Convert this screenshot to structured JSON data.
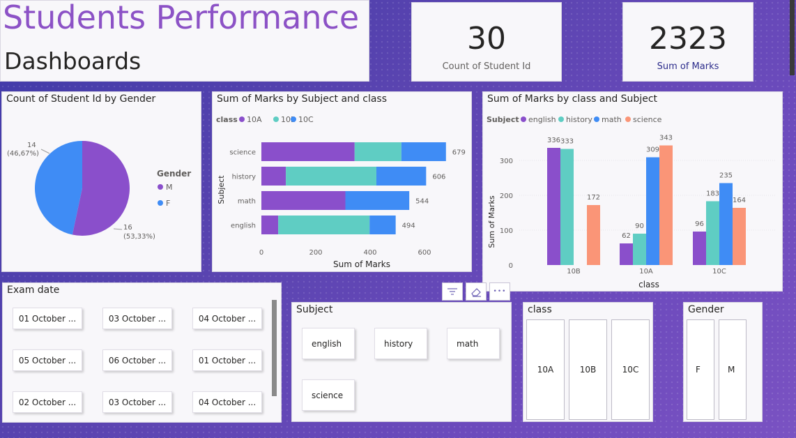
{
  "header": {
    "title": "Students Performance",
    "subtitle": "Dashboards"
  },
  "kpis": [
    {
      "value": "30",
      "label": "Count of Student Id",
      "label_color": "#605e5c"
    },
    {
      "value": "2323",
      "label": "Sum of Marks",
      "label_color": "#2a2a8a"
    }
  ],
  "colors": {
    "M": "#8a4fcb",
    "F": "#3f8cf5",
    "10A": "#8a4fcb",
    "10B": "#5fcdc3",
    "10C": "#3f8cf5",
    "english": "#8a4fcb",
    "history": "#5fcdc3",
    "math": "#3f8cf5",
    "science": "#fa9577"
  },
  "pie_card": {
    "title": "Count of Student Id by Gender",
    "legend_title": "Gender",
    "legend": [
      "M",
      "F"
    ],
    "labels": [
      {
        "value": "14",
        "pct": "(46,67%)"
      },
      {
        "value": "16",
        "pct": "(53,33%)"
      }
    ]
  },
  "hbar_card": {
    "title": "Sum of Marks by Subject and class",
    "legend_title": "class",
    "legend": [
      "10A",
      "10B",
      "10C"
    ],
    "xlabel": "Sum of Marks",
    "ylabel": "Subject",
    "x_ticks": [
      "0",
      "200",
      "400",
      "600"
    ]
  },
  "vbar_card": {
    "title": "Sum of Marks by class and Subject",
    "legend_title": "Subject",
    "legend": [
      "english",
      "history",
      "math",
      "science"
    ],
    "xlabel": "class",
    "ylabel": "Sum of Marks",
    "y_ticks": [
      "0",
      "100",
      "200",
      "300"
    ]
  },
  "chart_data": [
    {
      "type": "pie",
      "title": "Count of Student Id by Gender",
      "legend_title": "Gender",
      "categories": [
        "M",
        "F"
      ],
      "values": [
        16,
        14
      ],
      "percent": [
        53.33,
        46.67
      ]
    },
    {
      "type": "bar",
      "orientation": "horizontal",
      "stacked": true,
      "title": "Sum of Marks by Subject and class",
      "categories": [
        "science",
        "history",
        "math",
        "english"
      ],
      "series": [
        {
          "name": "10A",
          "values": [
            343,
            90,
            309,
            62
          ]
        },
        {
          "name": "10B",
          "values": [
            172,
            333,
            0,
            336
          ]
        },
        {
          "name": "10C",
          "values": [
            164,
            183,
            235,
            96
          ]
        }
      ],
      "totals": [
        679,
        606,
        544,
        494
      ],
      "xlabel": "Sum of Marks",
      "ylabel": "Subject",
      "xlim": [
        0,
        700
      ]
    },
    {
      "type": "bar",
      "orientation": "vertical",
      "stacked": false,
      "title": "Sum of Marks by class and Subject",
      "categories": [
        "10B",
        "10A",
        "10C"
      ],
      "series": [
        {
          "name": "english",
          "values": [
            336,
            62,
            96
          ]
        },
        {
          "name": "history",
          "values": [
            333,
            90,
            183
          ]
        },
        {
          "name": "math",
          "values": [
            null,
            309,
            235
          ]
        },
        {
          "name": "science",
          "values": [
            172,
            343,
            164
          ]
        }
      ],
      "xlabel": "class",
      "ylabel": "Sum of Marks",
      "ylim": [
        0,
        380
      ]
    }
  ],
  "slicers": {
    "exam_date": {
      "title": "Exam date",
      "items": [
        "01 October ...",
        "03 October ...",
        "04 October ...",
        "05 October ...",
        "06 October ...",
        "01 October ...",
        "02 October ...",
        "03 October ...",
        "04 October ..."
      ]
    },
    "subject": {
      "title": "Subject",
      "items": [
        "english",
        "history",
        "math",
        "science"
      ]
    },
    "class": {
      "title": "class",
      "items": [
        "10A",
        "10B",
        "10C"
      ]
    },
    "gender": {
      "title": "Gender",
      "items": [
        "F",
        "M"
      ]
    }
  },
  "toolbar": {
    "filter_icon": "filter-icon",
    "eraser_icon": "eraser-icon",
    "more_icon": "more-options-icon",
    "more_label": "•••"
  }
}
